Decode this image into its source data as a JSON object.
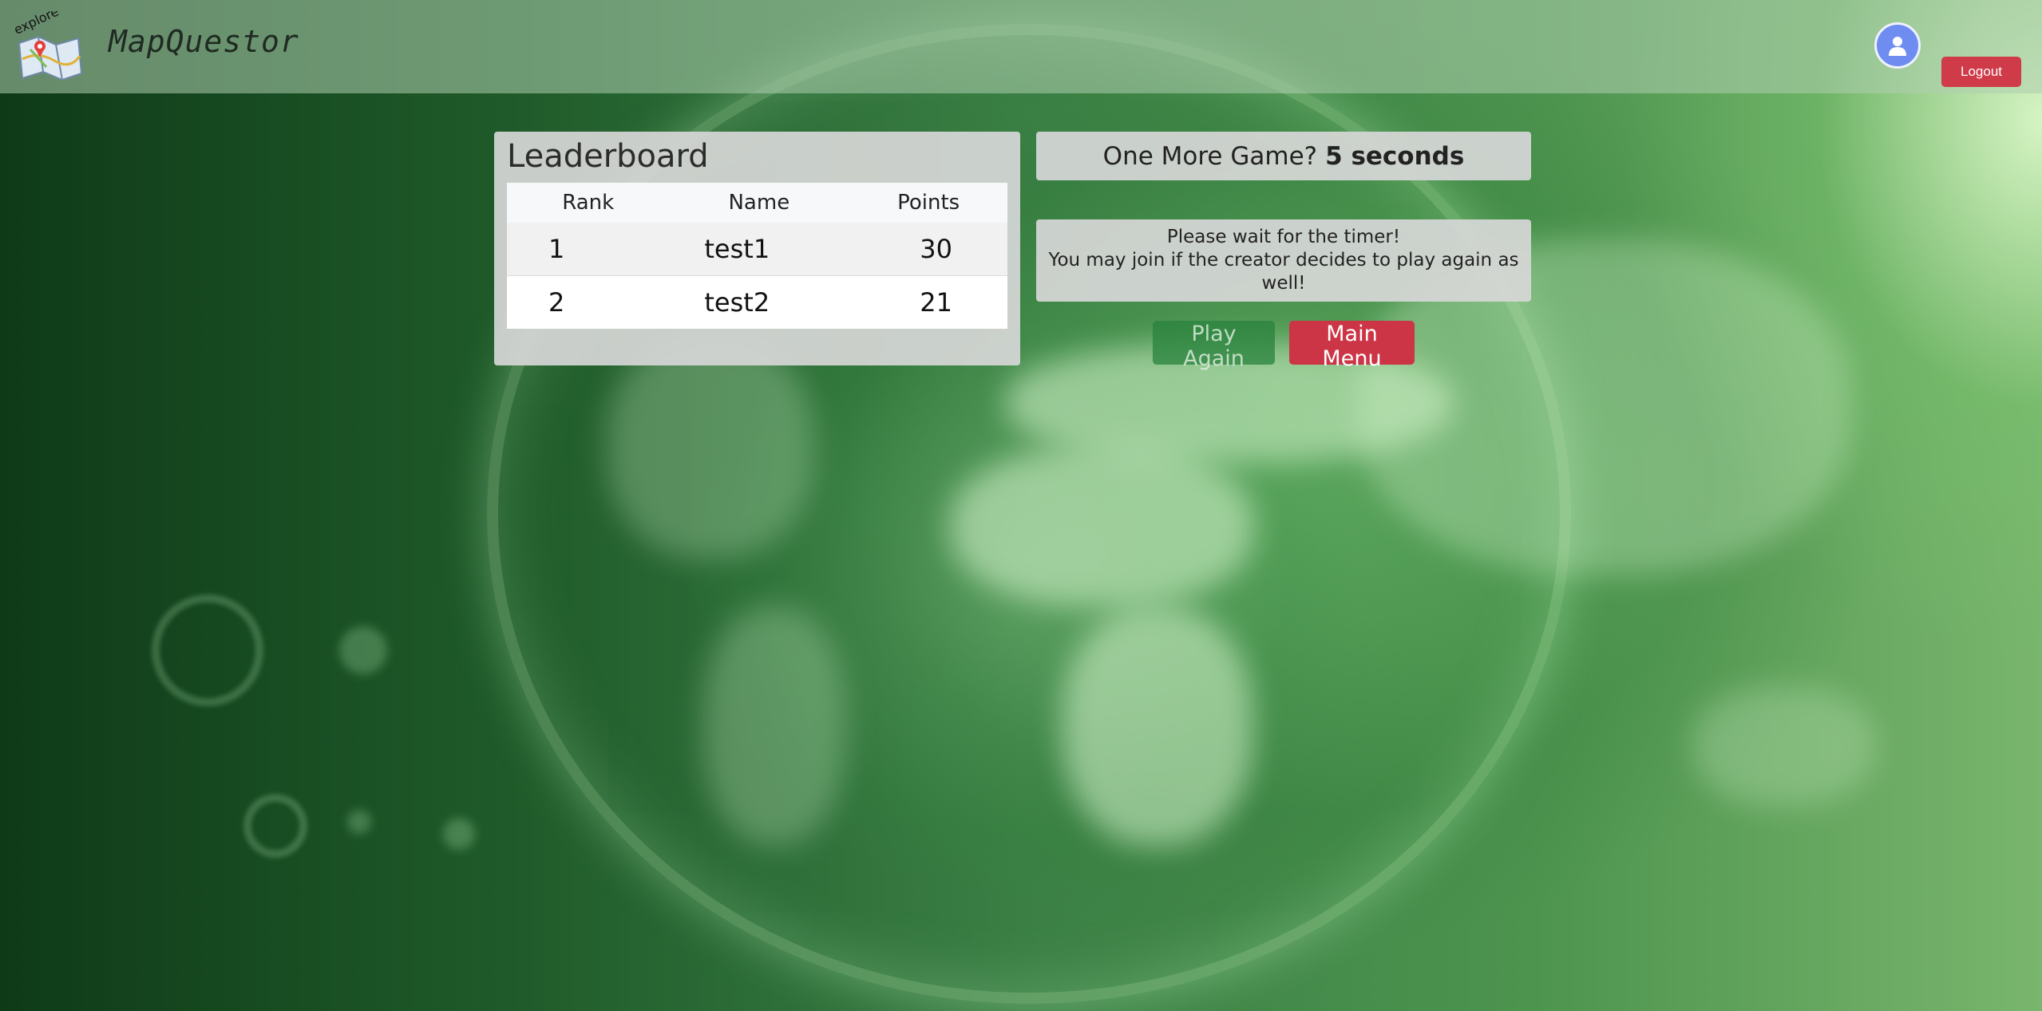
{
  "header": {
    "brand": "MapQuestor",
    "logo_text": "explore",
    "logout_label": "Logout"
  },
  "leaderboard": {
    "title": "Leaderboard",
    "columns": [
      "Rank",
      "Name",
      "Points"
    ],
    "rows": [
      {
        "rank": "1",
        "name": "test1",
        "points": "30"
      },
      {
        "rank": "2",
        "name": "test2",
        "points": "21"
      }
    ]
  },
  "lobby": {
    "timer_prefix": "One More Game?",
    "timer_value": "5 seconds",
    "wait_line1": "Please wait for the timer!",
    "wait_line2": "You may join if the creator decides to play again as well!",
    "play_again_label": "Play Again",
    "main_menu_label": "Main Menu"
  },
  "colors": {
    "danger": "#cf3b49",
    "success": "#28823c",
    "panel": "#d7d7d7"
  },
  "icons": {
    "avatar": "user-icon"
  }
}
